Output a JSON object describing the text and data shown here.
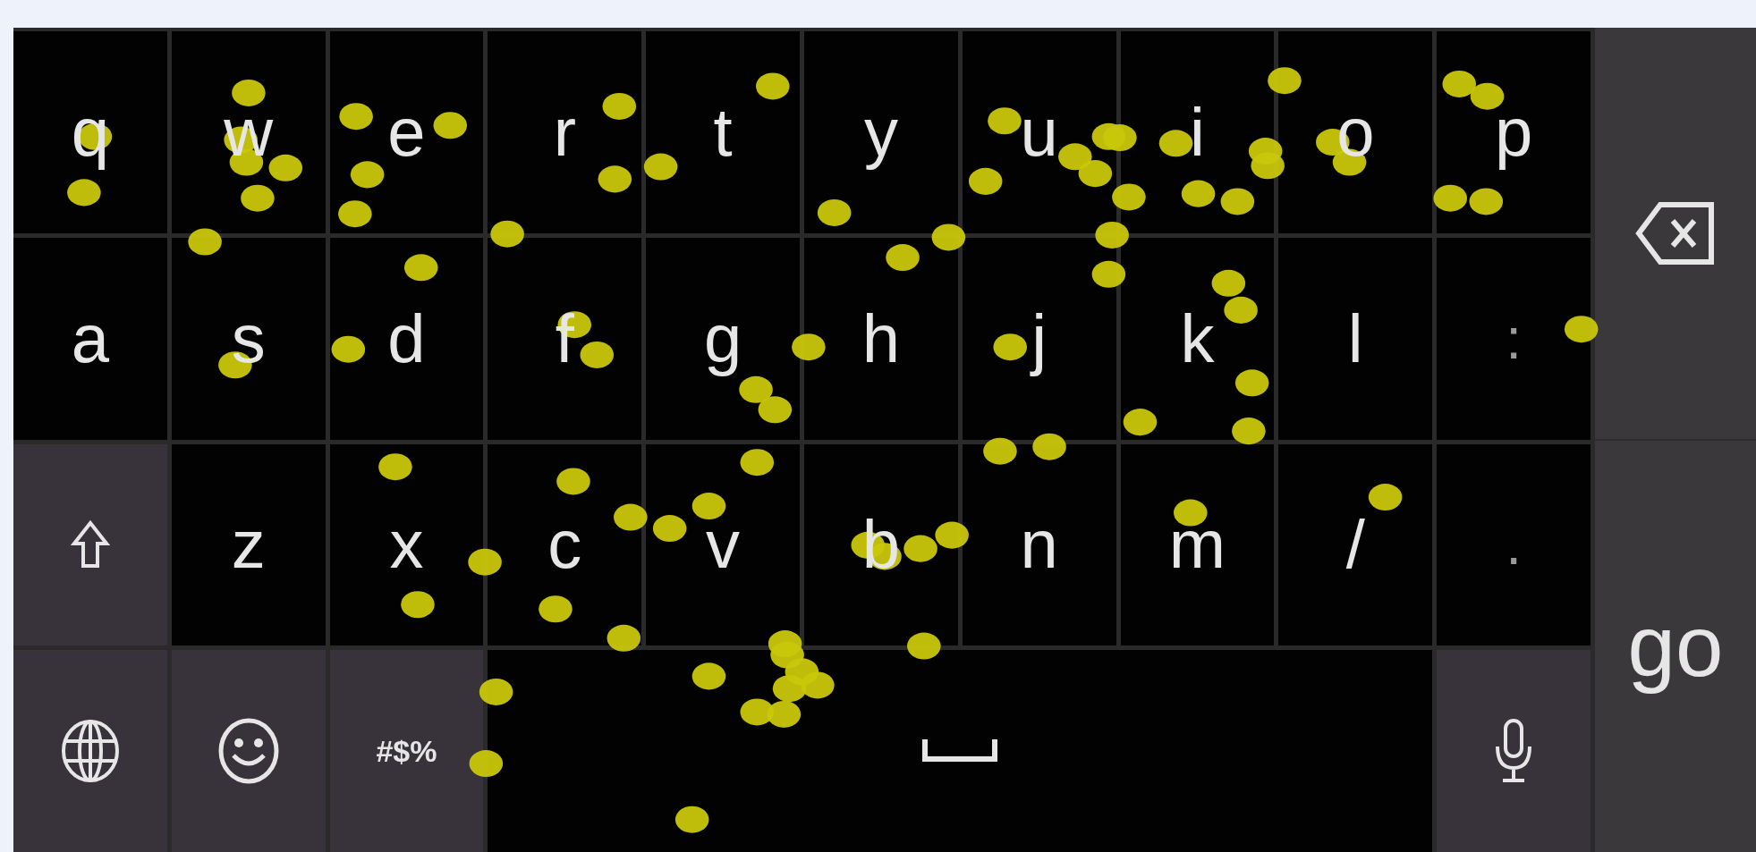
{
  "keyboard": {
    "rows": [
      [
        {
          "kind": "letter",
          "label": "q"
        },
        {
          "kind": "letter",
          "label": "w"
        },
        {
          "kind": "letter",
          "label": "e"
        },
        {
          "kind": "letter",
          "label": "r"
        },
        {
          "kind": "letter",
          "label": "t"
        },
        {
          "kind": "letter",
          "label": "y"
        },
        {
          "kind": "letter",
          "label": "u"
        },
        {
          "kind": "letter",
          "label": "i"
        },
        {
          "kind": "letter",
          "label": "o"
        },
        {
          "kind": "letter",
          "label": "p"
        }
      ],
      [
        {
          "kind": "letter",
          "label": "a"
        },
        {
          "kind": "letter",
          "label": "s"
        },
        {
          "kind": "letter",
          "label": "d"
        },
        {
          "kind": "letter",
          "label": "f"
        },
        {
          "kind": "letter",
          "label": "g"
        },
        {
          "kind": "letter",
          "label": "h"
        },
        {
          "kind": "letter",
          "label": "j"
        },
        {
          "kind": "letter",
          "label": "k"
        },
        {
          "kind": "letter",
          "label": "l"
        },
        {
          "kind": "punct",
          "label": ":"
        }
      ],
      [
        {
          "kind": "shift"
        },
        {
          "kind": "letter",
          "label": "z"
        },
        {
          "kind": "letter",
          "label": "x"
        },
        {
          "kind": "letter",
          "label": "c"
        },
        {
          "kind": "letter",
          "label": "v"
        },
        {
          "kind": "letter",
          "label": "b"
        },
        {
          "kind": "letter",
          "label": "n"
        },
        {
          "kind": "letter",
          "label": "m"
        },
        {
          "kind": "letter",
          "label": "/"
        },
        {
          "kind": "punct",
          "label": "."
        }
      ],
      [
        {
          "kind": "globe"
        },
        {
          "kind": "emoji"
        },
        {
          "kind": "symbols",
          "label": "#$%"
        },
        {
          "kind": "space"
        },
        {
          "kind": "mic"
        }
      ]
    ],
    "side_keys": [
      {
        "kind": "backspace"
      },
      {
        "kind": "go",
        "label": "go"
      }
    ]
  }
}
